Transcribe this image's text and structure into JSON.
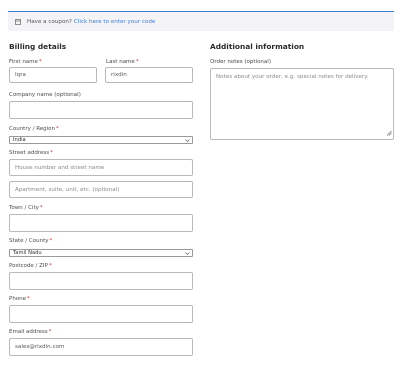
{
  "coupon": {
    "icon": "coupon-icon",
    "text": "Have a coupon?",
    "link": "Click here to enter your code"
  },
  "billing": {
    "title": "Billing details",
    "first_name": {
      "label": "First name",
      "required": "*",
      "value": "Iqra"
    },
    "last_name": {
      "label": "Last name",
      "required": "*",
      "value": "rixdin"
    },
    "company": {
      "label": "Company name (optional)",
      "value": ""
    },
    "country": {
      "label": "Country / Region",
      "required": "*",
      "selected": "India"
    },
    "street": {
      "label": "Street address",
      "required": "*",
      "placeholder1": "House number and street name",
      "placeholder2": "Apartment, suite, unit, etc. (optional)"
    },
    "town": {
      "label": "Town / City",
      "required": "*",
      "value": ""
    },
    "state": {
      "label": "State / County",
      "required": "*",
      "selected": "Tamil Nadu"
    },
    "postcode": {
      "label": "Postcode / ZIP",
      "required": "*",
      "value": ""
    },
    "phone": {
      "label": "Phone",
      "required": "*",
      "value": ""
    },
    "email": {
      "label": "Email address",
      "required": "*",
      "value": "sales@rixdin.com"
    }
  },
  "additional": {
    "title": "Additional information",
    "notes": {
      "label": "Order notes (optional)",
      "placeholder": "Notes about your order, e.g. special notes for delivery."
    }
  },
  "colors": {
    "accent": "#3f7bd8",
    "required": "#d42e2e"
  }
}
